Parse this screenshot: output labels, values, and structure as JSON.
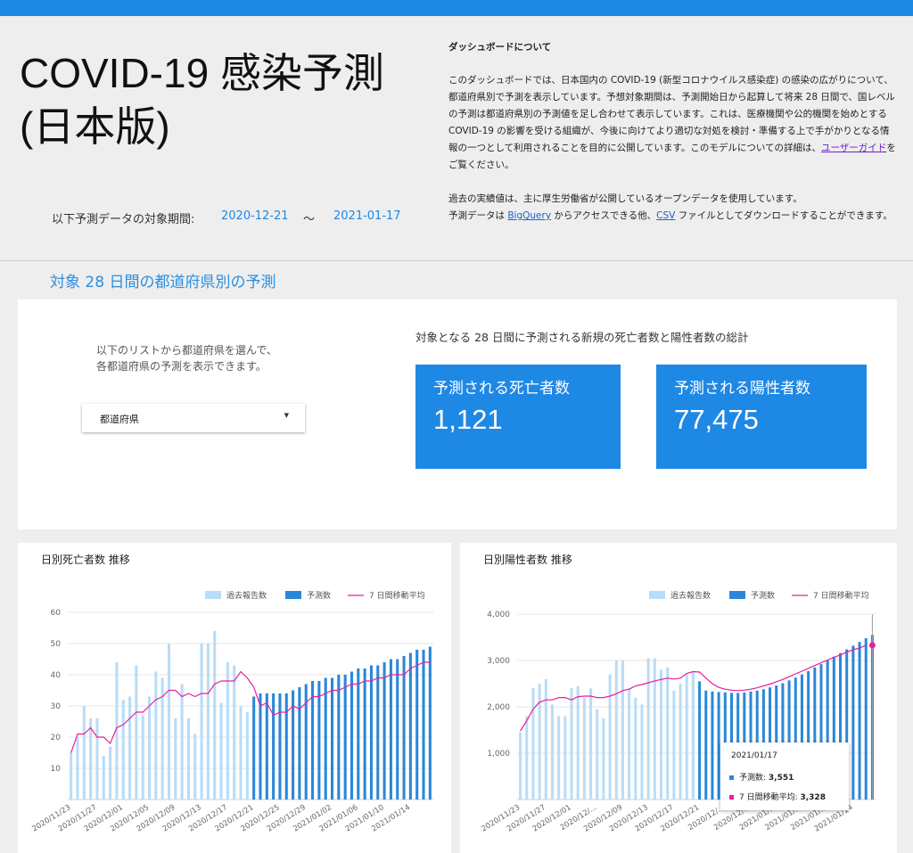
{
  "header": {
    "title_line1": "COVID-19 感染予測",
    "title_line2": "(日本版)",
    "period_label": "以下予測データの対象期間:",
    "period_start": "2020-12-21",
    "period_sep": "〜",
    "period_end": "2021-01-17"
  },
  "about": {
    "heading": "ダッシュボードについて",
    "p1_text": "このダッシュボードでは、日本国内の COVID-19 (新型コロナウイルス感染症) の感染の広がりについて、都道府県別で予測を表示しています。予想対象期間は、予測開始日から起算して将来 28 日間で、国レベルの予測は都道府県別の予測値を足し合わせて表示しています。これは、医療機関や公的機関を始めとする COVID-19 の影響を受ける組織が、今後に向けてより適切な対処を検討・準備する上で手がかりとなる情報の一つとして利用されることを目的に公開しています。このモデルについての詳細は、",
    "p1_link": "ユーザーガイド",
    "p1_end": "をご覧ください。",
    "p2_line1": "過去の実績値は、主に厚生労働省が公開しているオープンデータを使用しています。",
    "p2_pre": "予測データは ",
    "p2_link1": "BigQuery",
    "p2_mid": " からアクセスできる他、",
    "p2_link2": "CSV",
    "p2_end": " ファイルとしてダウンロードすることができます。"
  },
  "section": {
    "title": "対象 28 日間の都道府県別の予測"
  },
  "selector": {
    "note_line1": "以下のリストから都道府県を選んで、",
    "note_line2": "各都道府県の予測を表示できます。",
    "dropdown_label": "都道府県",
    "caret": "▼"
  },
  "totals": {
    "caption": "対象となる 28 日間に予測される新規の死亡者数と陽性者数の総計",
    "deaths_label": "予測される死亡者数",
    "deaths_value": "1,121",
    "cases_label": "予測される陽性者数",
    "cases_value": "77,475"
  },
  "colors": {
    "accent": "#1e88e5",
    "reported_bar": "#b9dcf7",
    "predicted_bar": "#2b87d8",
    "moving_avg": "#e91e9c"
  },
  "legend": {
    "reported": "過去報告数",
    "predicted": "予測数",
    "moving_avg": "7 日間移動平均"
  },
  "chart_data": [
    {
      "type": "bar",
      "title": "日別死亡者数 推移",
      "ylim": [
        0,
        60
      ],
      "y_ticks": [
        "10",
        "20",
        "30",
        "40",
        "50",
        "60"
      ],
      "x_tick_labels": [
        "2020/11/23",
        "2020/11/27",
        "2020/12/01",
        "2020/12/05",
        "2020/12/09",
        "2020/12/13",
        "2020/12/17",
        "2020/12/21",
        "2020/12/25",
        "2020/12/29",
        "2021/01/02",
        "2021/01/06",
        "2021/01/10",
        "2021/01/14"
      ],
      "grid": true,
      "legend_position": "top-right",
      "series": [
        {
          "name": "過去報告数",
          "start_index": 0,
          "values": [
            15,
            20,
            30,
            26,
            26,
            14,
            17,
            44,
            32,
            33,
            43,
            27,
            33,
            41,
            39,
            50,
            26,
            37,
            26,
            21,
            50,
            50,
            54,
            31,
            44,
            43,
            30,
            28
          ]
        },
        {
          "name": "予測数",
          "start_index": 28,
          "values": [
            33,
            34,
            34,
            34,
            34,
            34,
            35,
            36,
            37,
            38,
            38,
            39,
            39,
            40,
            40,
            41,
            42,
            42,
            43,
            43,
            44,
            45,
            45,
            46,
            47,
            48,
            48,
            49
          ]
        },
        {
          "name": "7 日間移動平均",
          "start_index": 0,
          "values": [
            15,
            21,
            21,
            23,
            20,
            20,
            18,
            23,
            24,
            26,
            28,
            28,
            30,
            32,
            33,
            35,
            35,
            33,
            34,
            33,
            34,
            34,
            37,
            38,
            38,
            38,
            41,
            39,
            36,
            30,
            31,
            27,
            28,
            28,
            30,
            29,
            31,
            33,
            33,
            34,
            35,
            35,
            36,
            37,
            37,
            38,
            38,
            39,
            39,
            40,
            40,
            40,
            42,
            43,
            44,
            44
          ]
        }
      ]
    },
    {
      "type": "bar",
      "title": "日別陽性者数 推移",
      "ylim": [
        0,
        4000
      ],
      "y_ticks": [
        "1,000",
        "2,000",
        "3,000",
        "4,000"
      ],
      "x_tick_labels": [
        "2020/11/23",
        "2020/11/27",
        "2020/12/01",
        "2020/12/...",
        "2020/12/09",
        "2020/12/13",
        "2020/12/17",
        "2020/12/21",
        "2020/12/...",
        "2020/12/...",
        "2021/01/...",
        "2021/01/...",
        "2021/01/...",
        "2021/01/14"
      ],
      "grid": true,
      "legend_position": "top-right",
      "series": [
        {
          "name": "過去報告数",
          "start_index": 0,
          "values": [
            1450,
            1800,
            2400,
            2500,
            2600,
            2050,
            1800,
            1800,
            2400,
            2450,
            2200,
            2400,
            1950,
            1750,
            2700,
            3000,
            3000,
            2400,
            2200,
            2050,
            3050,
            3050,
            2800,
            2850,
            2350,
            2500,
            2700,
            2750
          ]
        },
        {
          "name": "予測数",
          "start_index": 28,
          "values": [
            2550,
            2350,
            2330,
            2320,
            2310,
            2300,
            2300,
            2310,
            2330,
            2350,
            2380,
            2420,
            2460,
            2510,
            2570,
            2630,
            2700,
            2770,
            2850,
            2920,
            3000,
            3080,
            3160,
            3240,
            3320,
            3400,
            3480,
            3551
          ]
        },
        {
          "name": "7 日間移動平均",
          "start_index": 0,
          "values": [
            1480,
            1700,
            1950,
            2100,
            2150,
            2150,
            2200,
            2200,
            2150,
            2220,
            2230,
            2230,
            2200,
            2200,
            2230,
            2280,
            2350,
            2380,
            2450,
            2480,
            2520,
            2560,
            2590,
            2620,
            2600,
            2620,
            2720,
            2760,
            2750,
            2620,
            2500,
            2420,
            2380,
            2360,
            2350,
            2360,
            2380,
            2410,
            2450,
            2490,
            2540,
            2590,
            2650,
            2710,
            2770,
            2830,
            2890,
            2950,
            3010,
            3070,
            3120,
            3180,
            3230,
            3270,
            3328
          ]
        }
      ],
      "tooltip": {
        "date": "2021/01/17",
        "predicted_label": "予測数: ",
        "predicted_value": "3,551",
        "avg_label": "7 日間移動平均: ",
        "avg_value": "3,328"
      }
    }
  ]
}
